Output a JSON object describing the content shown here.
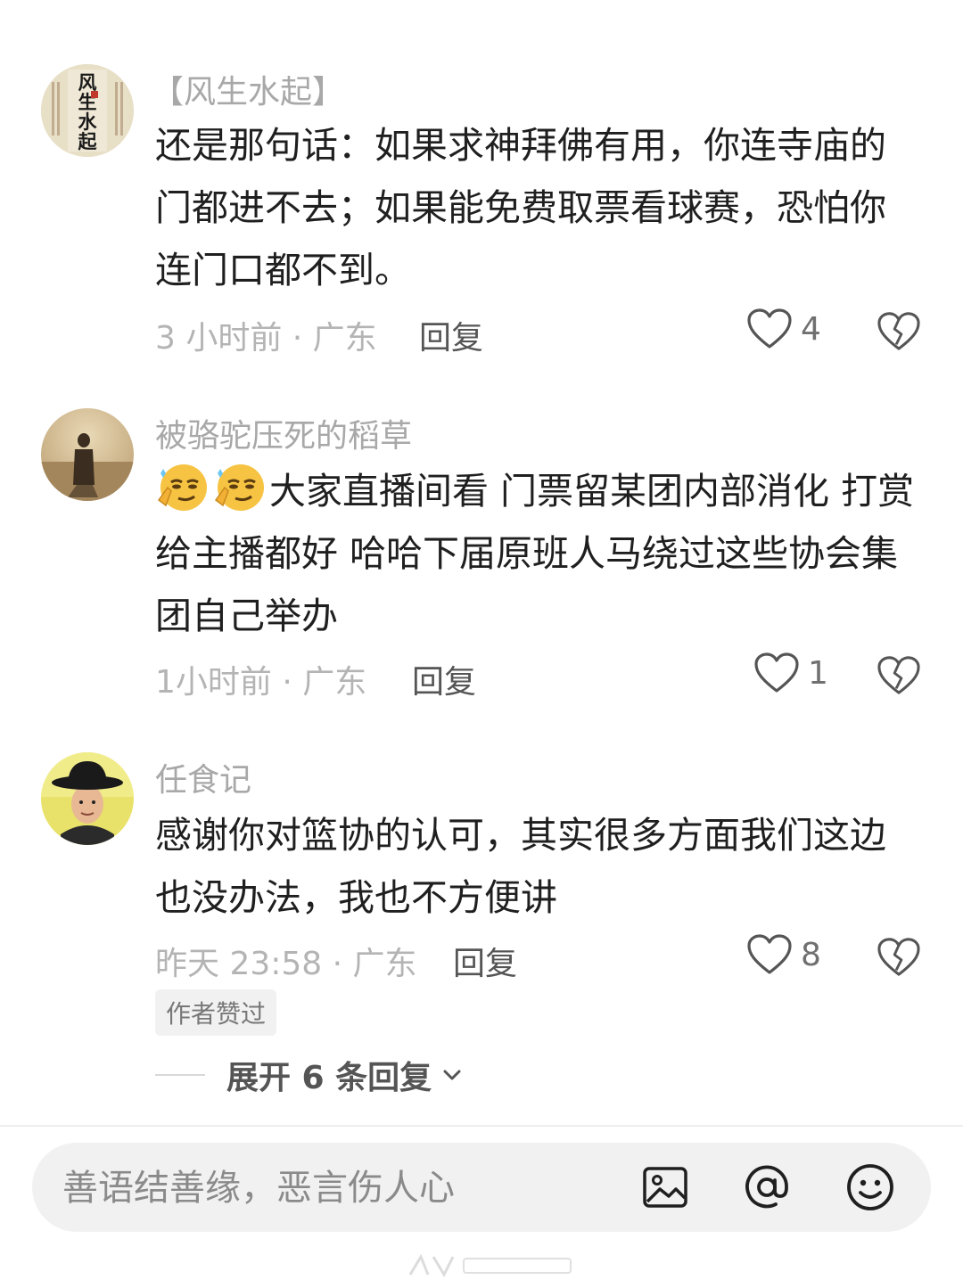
{
  "comments": [
    {
      "username": "【风生水起】",
      "avatar_text": "风生水起",
      "text": "还是那句话：如果求神拜佛有用，你连寺庙的门都进不去；如果能免费取票看球赛，恐怕你连门口都不到。",
      "time_location": "3 小时前 · 广东",
      "reply_label": "回复",
      "likes": "4"
    },
    {
      "username": "被骆驼压死的稻草",
      "text": "大家直播间看 门票留某团内部消化 打赏给主播都好 哈哈下届原班人马绕过这些协会集团自己举办",
      "emojis": [
        "smirk-emoji",
        "smirk-emoji"
      ],
      "time_location": "1小时前 · 广东",
      "reply_label": "回复",
      "likes": "1"
    },
    {
      "username": "任食记",
      "text": "感谢你对篮协的认可，其实很多方面我们这边也没办法，我也不方便讲",
      "time_location": "昨天 23:58 · 广东",
      "reply_label": "回复",
      "likes": "8",
      "badge": "作者赞过",
      "expand_label": "展开 6 条回复"
    }
  ],
  "input": {
    "placeholder": "善语结善缘，恶言伤人心"
  },
  "icons": {
    "like": "heart-outline-icon",
    "dislike": "broken-heart-icon",
    "image": "image-icon",
    "mention": "at-icon",
    "emoji": "smiley-icon",
    "expand": "chevron-down-icon"
  },
  "colors": {
    "accent_text": "#1f1f1f",
    "muted_text": "#a8a8a8",
    "input_bg": "#f1f1f1"
  }
}
